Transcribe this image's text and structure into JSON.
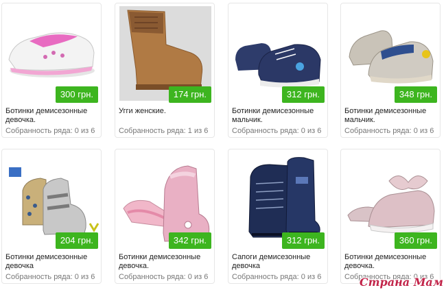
{
  "products": [
    {
      "title": "Ботинки демисезонные девочка.",
      "price": "300 грн.",
      "status": "Собранность ряда: 0 из 6",
      "icon": "white-pink-sneaker-icon"
    },
    {
      "title": "Угги женские.",
      "price": "174 грн.",
      "status": "Собранность ряда: 1 из 6",
      "icon": "tan-knit-boot-icon"
    },
    {
      "title": "Ботинки демисезонные мальчик.",
      "price": "312 грн.",
      "status": "Собранность ряда: 0 из 6",
      "icon": "navy-sneaker-boot-icon"
    },
    {
      "title": "Ботинки демисезонные мальчик.",
      "price": "348 грн.",
      "status": "Собранность ряда: 0 из 6",
      "icon": "grey-blue-sneaker-icon"
    },
    {
      "title": "Ботинки демисезонные девочка",
      "price": "204 грн.",
      "status": "Собранность ряда: 0 из 6",
      "icon": "leopard-boot-icon"
    },
    {
      "title": "Ботинки демисезонные девочка.",
      "price": "342 грн.",
      "status": "Собранность ряда: 0 из 6",
      "icon": "pink-boot-icon"
    },
    {
      "title": "Сапоги демисезонные девочка",
      "price": "312 грн.",
      "status": "Собранность ряда: 0 из 6",
      "icon": "navy-patent-boot-icon"
    },
    {
      "title": "Ботинки демисезонные девочка.",
      "price": "360 грн.",
      "status": "Собранность ряда: 0 из 6",
      "icon": "pink-bow-shoe-icon"
    }
  ],
  "watermark": "Страна Мам",
  "colors": {
    "price_bg": "#3db51f",
    "watermark": "#c2254a"
  }
}
